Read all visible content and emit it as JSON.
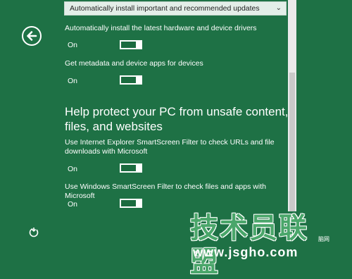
{
  "dropdown": {
    "selected": "Automatically install important and recommended updates"
  },
  "settings": [
    {
      "label": "Automatically install the latest hardware and device drivers",
      "state": "On",
      "on": true
    },
    {
      "label": "Get metadata and device apps for devices",
      "state": "On",
      "on": true
    }
  ],
  "section": {
    "heading": "Help protect your PC from unsafe content, files, and websites",
    "items": [
      {
        "label": "Use Internet Explorer SmartScreen Filter to check URLs and file downloads with Microsoft",
        "state": "On",
        "on": true
      },
      {
        "label": "Use Windows SmartScreen Filter to check files and apps with Microsoft",
        "state": "On",
        "on": true
      }
    ]
  },
  "icons": {
    "back": "back-arrow-icon",
    "ease_of_access": "ease-of-access-icon",
    "dropdown": "chevron-down-icon"
  },
  "watermark": {
    "text": "技术员联盟",
    "url": "www.jsgho.com",
    "small": "脑网"
  },
  "colors": {
    "background": "#1e7145",
    "dropdown_bg": "#e3eee8",
    "toggle_fill": "#1b6b3f"
  }
}
